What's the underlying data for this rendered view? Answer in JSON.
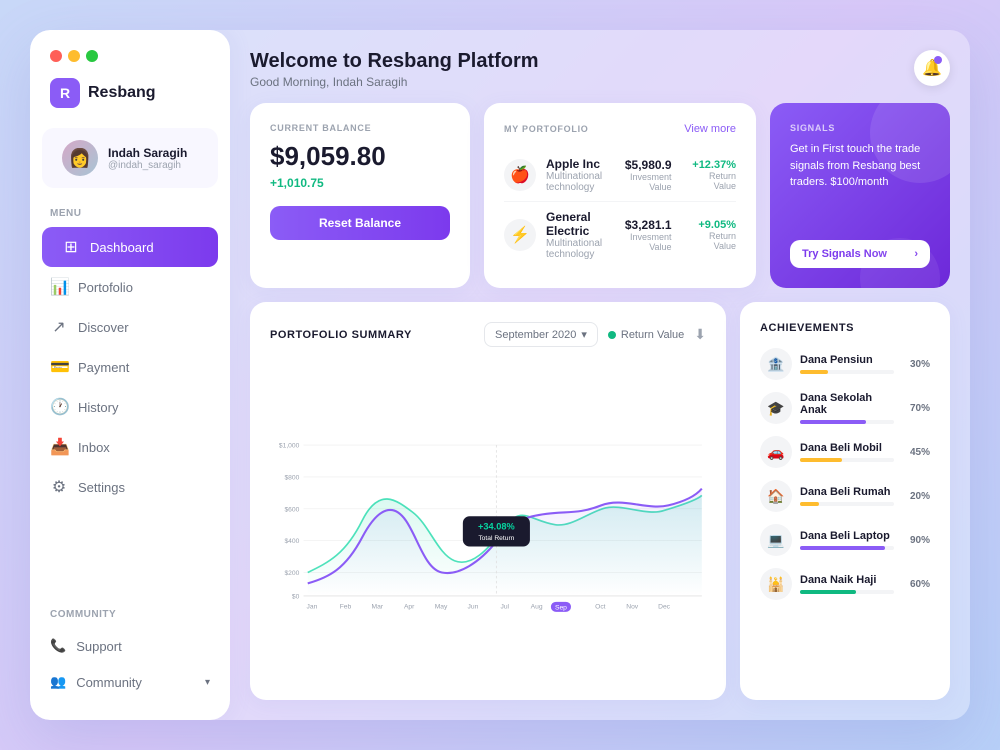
{
  "window": {
    "title": "Resbang Platform"
  },
  "sidebar": {
    "logo": "R",
    "app_name": "Resbang",
    "user": {
      "name": "Indah Saragih",
      "handle": "@indah_saragih",
      "avatar": "👩"
    },
    "menu_label": "MENU",
    "nav_items": [
      {
        "id": "dashboard",
        "label": "Dashboard",
        "icon": "⊞",
        "active": true
      },
      {
        "id": "portfolio",
        "label": "Portofolio",
        "icon": "📊",
        "active": false
      },
      {
        "id": "discover",
        "label": "Discover",
        "icon": "↗",
        "active": false
      },
      {
        "id": "payment",
        "label": "Payment",
        "icon": "💳",
        "active": false
      },
      {
        "id": "history",
        "label": "History",
        "icon": "🕐",
        "active": false
      },
      {
        "id": "inbox",
        "label": "Inbox",
        "icon": "📥",
        "active": false
      },
      {
        "id": "settings",
        "label": "Settings",
        "icon": "⚙",
        "active": false
      }
    ],
    "community_label": "COMMUNITY",
    "community_items": [
      {
        "id": "support",
        "label": "Support",
        "icon": "📞"
      },
      {
        "id": "community",
        "label": "Community",
        "icon": "👥",
        "has_chevron": true
      }
    ]
  },
  "header": {
    "welcome": "Welcome to",
    "brand": "Resbang Platform",
    "greeting": "Good Morning, Indah Saragih",
    "notif_icon": "🔔"
  },
  "balance_card": {
    "label": "CURRENT BALANCE",
    "amount": "$9,059.80",
    "change": "+1,010.75",
    "reset_label": "Reset Balance"
  },
  "portfolio_card": {
    "label": "MY PORTOFOLIO",
    "view_more": "View more",
    "items": [
      {
        "name": "Apple Inc",
        "category": "Multinational technology",
        "icon": "🍎",
        "value": "$5,980.9",
        "value_label": "Invesment Value",
        "return": "+12.37%",
        "return_label": "Return Value"
      },
      {
        "name": "General Electric",
        "category": "Multinational technology",
        "icon": "⚡",
        "value": "$3,281.1",
        "value_label": "Invesment Value",
        "return": "+9.05%",
        "return_label": "Return Value"
      }
    ]
  },
  "signals_card": {
    "label": "SIGNALS",
    "description": "Get in First touch the trade signals from Resbang best traders. $100/month",
    "button_label": "Try Signals Now"
  },
  "chart": {
    "title": "PORTOFOLIO SUMMARY",
    "period": "September 2020",
    "legend": "Return Value",
    "tooltip_value": "+34.08%",
    "tooltip_label": "Total Return",
    "months": [
      "Jan",
      "Feb",
      "Mar",
      "Apr",
      "May",
      "Jun",
      "Jul",
      "Aug",
      "Sep",
      "Oct",
      "Nov",
      "Dec"
    ],
    "y_labels": [
      "$1,000",
      "$800",
      "$600",
      "$400",
      "$200",
      "$0"
    ]
  },
  "achievements": {
    "title": "ACHIEVEMENTS",
    "items": [
      {
        "name": "Dana Pensiun",
        "icon": "🏦",
        "percent": 30,
        "percent_label": "30%",
        "color": "#FEBC2E"
      },
      {
        "name": "Dana Sekolah Anak",
        "icon": "🎓",
        "percent": 70,
        "percent_label": "70%",
        "color": "#8B5CF6"
      },
      {
        "name": "Dana Beli Mobil",
        "icon": "🚗",
        "percent": 45,
        "percent_label": "45%",
        "color": "#FEBC2E"
      },
      {
        "name": "Dana Beli Rumah",
        "icon": "🏠",
        "percent": 20,
        "percent_label": "20%",
        "color": "#FEBC2E"
      },
      {
        "name": "Dana Beli Laptop",
        "icon": "💻",
        "percent": 90,
        "percent_label": "90%",
        "color": "#8B5CF6"
      },
      {
        "name": "Dana Naik Haji",
        "icon": "🕌",
        "percent": 60,
        "percent_label": "60%",
        "color": "#10b981"
      }
    ]
  }
}
